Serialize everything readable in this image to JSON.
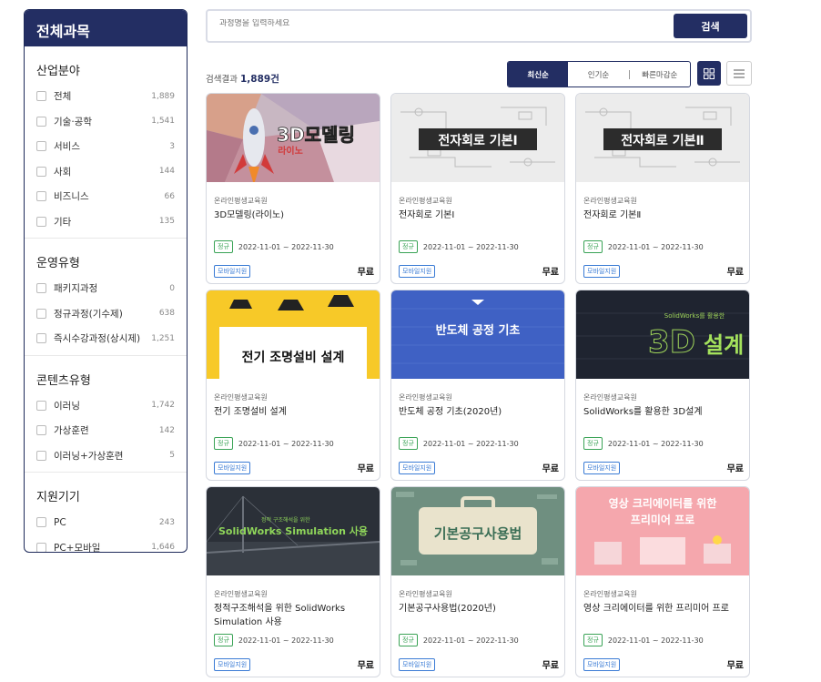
{
  "sidebar": {
    "header": "전체과목",
    "groups": [
      {
        "title": "산업분야",
        "items": [
          {
            "label": "전체",
            "count": "1,889"
          },
          {
            "label": "기술·공학",
            "count": "1,541"
          },
          {
            "label": "서비스",
            "count": "3"
          },
          {
            "label": "사회",
            "count": "144"
          },
          {
            "label": "비즈니스",
            "count": "66"
          },
          {
            "label": "기타",
            "count": "135"
          }
        ]
      },
      {
        "title": "운영유형",
        "items": [
          {
            "label": "패키지과정",
            "count": "0"
          },
          {
            "label": "정규과정(기수제)",
            "count": "638"
          },
          {
            "label": "즉시수강과정(상시제)",
            "count": "1,251"
          }
        ]
      },
      {
        "title": "콘텐츠유형",
        "items": [
          {
            "label": "이러닝",
            "count": "1,742"
          },
          {
            "label": "가상훈련",
            "count": "142"
          },
          {
            "label": "이러닝+가상훈련",
            "count": "5"
          }
        ]
      },
      {
        "title": "지원기기",
        "items": [
          {
            "label": "PC",
            "count": "243"
          },
          {
            "label": "PC+모바일",
            "count": "1,646"
          }
        ]
      }
    ]
  },
  "search": {
    "placeholder": "과정명을 입력하세요",
    "button": "검색"
  },
  "results": {
    "label": "검색결과",
    "count": "1,889건"
  },
  "sort": {
    "options": [
      "최신순",
      "인기순",
      "빠른마감순"
    ],
    "active": "최신순"
  },
  "colors": {
    "navy": "#232e63",
    "green": "#3aa356",
    "blue": "#3a7bd5"
  },
  "cards": [
    {
      "org": "온라인평생교육원",
      "title": "3D모델링(라이노)",
      "thumb_text": "3D모델링",
      "thumb_sub": "라이노",
      "type": "정규",
      "period": "2022-11-01 ~ 2022-11-30",
      "device": "모바일지원",
      "price": "무료"
    },
    {
      "org": "온라인평생교육원",
      "title": "전자회로 기본Ⅰ",
      "thumb_text": "전자회로 기본Ⅰ",
      "type": "정규",
      "period": "2022-11-01 ~ 2022-11-30",
      "device": "모바일지원",
      "price": "무료"
    },
    {
      "org": "온라인평생교육원",
      "title": "전자회로 기본Ⅱ",
      "thumb_text": "전자회로 기본Ⅱ",
      "type": "정규",
      "period": "2022-11-01 ~ 2022-11-30",
      "device": "모바일지원",
      "price": "무료"
    },
    {
      "org": "온라인평생교육원",
      "title": "전기 조명설비 설계",
      "thumb_text": "전기 조명설비 설계",
      "type": "정규",
      "period": "2022-11-01 ~ 2022-11-30",
      "device": "모바일지원",
      "price": "무료"
    },
    {
      "org": "온라인평생교육원",
      "title": "반도체 공정 기초(2020년)",
      "thumb_text": "반도체 공정 기초",
      "type": "정규",
      "period": "2022-11-01 ~ 2022-11-30",
      "device": "모바일지원",
      "price": "무료"
    },
    {
      "org": "온라인평생교육원",
      "title": "SolidWorks를 활용한 3D설계",
      "thumb_text": "3D설계",
      "thumb_sub": "SolidWorks를 활용한",
      "type": "정규",
      "period": "2022-11-01 ~ 2022-11-30",
      "device": "모바일지원",
      "price": "무료"
    },
    {
      "org": "온라인평생교육원",
      "title": "정적구조해석을 위한 SolidWorks Simulation 사용",
      "thumb_text": "SolidWorks Simulation 사용",
      "thumb_sub": "정적 구조해석을 위한",
      "type": "정규",
      "period": "2022-11-01 ~ 2022-11-30",
      "device": "모바일지원",
      "price": "무료"
    },
    {
      "org": "온라인평생교육원",
      "title": "기본공구사용법(2020년)",
      "thumb_text": "기본공구사용법",
      "type": "정규",
      "period": "2022-11-01 ~ 2022-11-30",
      "device": "모바일지원",
      "price": "무료"
    },
    {
      "org": "온라인평생교육원",
      "title": "영상 크리에이터를 위한 프리미어 프로",
      "thumb_text": "영상 크리에이터를 위한",
      "thumb_sub": "프리미어 프로",
      "type": "정규",
      "period": "2022-11-01 ~ 2022-11-30",
      "device": "모바일지원",
      "price": "무료"
    }
  ]
}
